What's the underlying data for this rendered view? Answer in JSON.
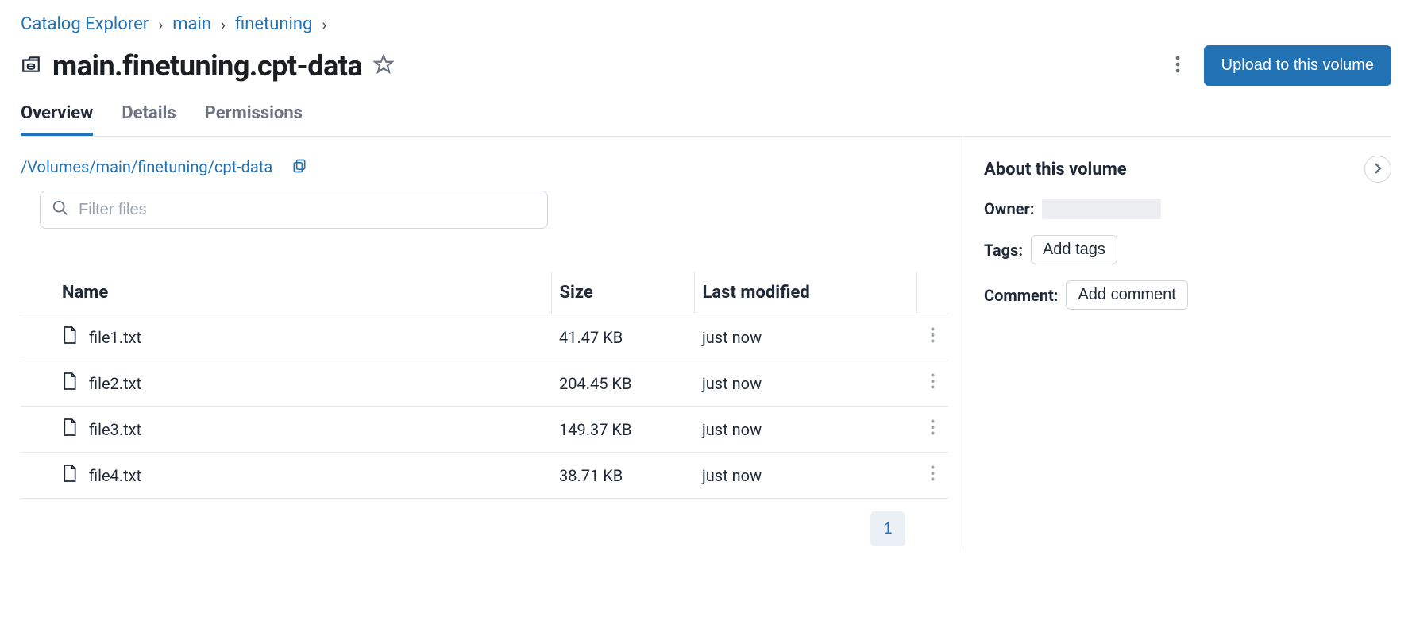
{
  "breadcrumb": {
    "items": [
      "Catalog Explorer",
      "main",
      "finetuning"
    ]
  },
  "page_title": "main.finetuning.cpt-data",
  "upload_button": "Upload to this volume",
  "tabs": {
    "overview": "Overview",
    "details": "Details",
    "permissions": "Permissions"
  },
  "volume_path": "/Volumes/main/finetuning/cpt-data",
  "filter_placeholder": "Filter files",
  "table": {
    "headers": {
      "name": "Name",
      "size": "Size",
      "mod": "Last modified"
    },
    "rows": [
      {
        "name": "file1.txt",
        "size": "41.47 KB",
        "mod": "just now"
      },
      {
        "name": "file2.txt",
        "size": "204.45 KB",
        "mod": "just now"
      },
      {
        "name": "file3.txt",
        "size": "149.37 KB",
        "mod": "just now"
      },
      {
        "name": "file4.txt",
        "size": "38.71 KB",
        "mod": "just now"
      }
    ]
  },
  "pagination": {
    "current": "1"
  },
  "side": {
    "title": "About this volume",
    "owner_label": "Owner:",
    "tags_label": "Tags:",
    "add_tags": "Add tags",
    "comment_label": "Comment:",
    "add_comment": "Add comment"
  }
}
